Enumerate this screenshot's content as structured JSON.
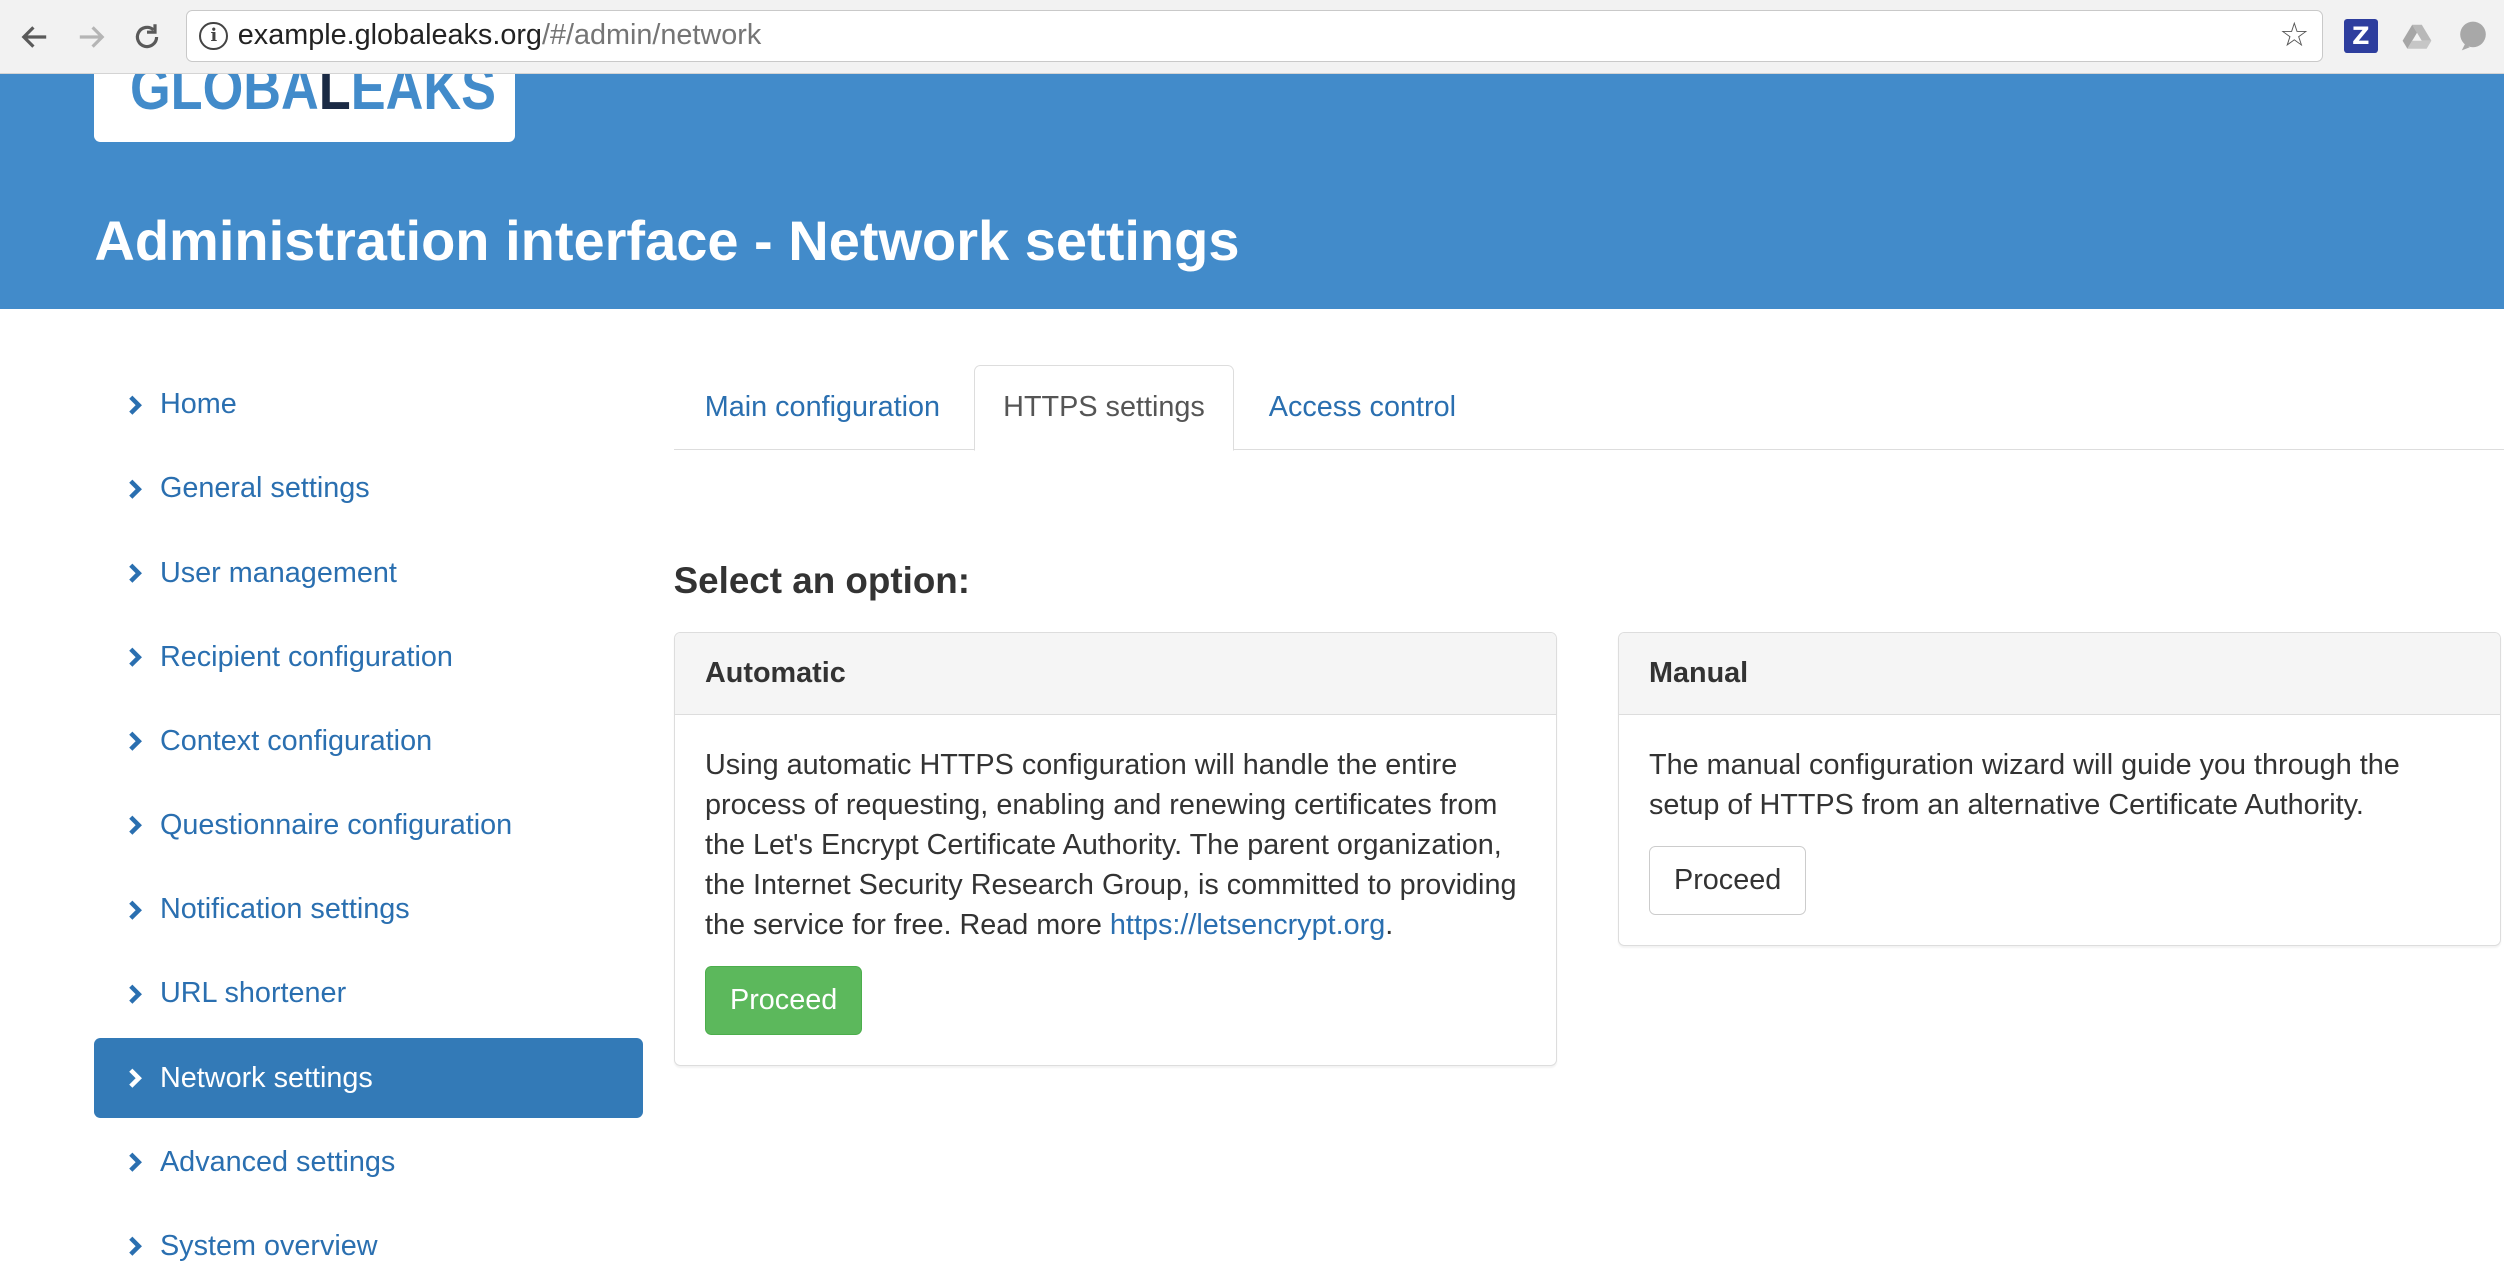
{
  "browser": {
    "url_host": "example.globaleaks.org",
    "url_path": "/#/admin/network",
    "extension_z_label": "Z"
  },
  "header": {
    "logo_part1": "GLOBA",
    "logo_part2": "L",
    "logo_part3": "EAKS",
    "title": "Administration interface - Network settings"
  },
  "sidebar": {
    "items": [
      {
        "label": "Home",
        "active": false
      },
      {
        "label": "General settings",
        "active": false
      },
      {
        "label": "User management",
        "active": false
      },
      {
        "label": "Recipient configuration",
        "active": false
      },
      {
        "label": "Context configuration",
        "active": false
      },
      {
        "label": "Questionnaire configuration",
        "active": false
      },
      {
        "label": "Notification settings",
        "active": false
      },
      {
        "label": "URL shortener",
        "active": false
      },
      {
        "label": "Network settings",
        "active": true
      },
      {
        "label": "Advanced settings",
        "active": false
      },
      {
        "label": "System overview",
        "active": false
      }
    ]
  },
  "tabs": [
    {
      "label": "Main configuration",
      "active": false
    },
    {
      "label": "HTTPS settings",
      "active": true
    },
    {
      "label": "Access control",
      "active": false
    }
  ],
  "main": {
    "section_title": "Select an option:",
    "automatic": {
      "heading": "Automatic",
      "body_text": "Using automatic HTTPS configuration will handle the entire process of requesting, enabling and renewing certificates from the Let's Encrypt Certificate Authority. The parent organization, the Internet Security Research Group, is committed to providing the service for free. Read more ",
      "link_text": "https://letsencrypt.org",
      "body_suffix": ".",
      "button_label": "Proceed"
    },
    "manual": {
      "heading": "Manual",
      "body_text": "The manual configuration wizard will guide you through the setup of HTTPS from an alternative Certificate Authority.",
      "button_label": "Proceed"
    }
  },
  "colors": {
    "header_blue": "#428bca",
    "link_blue": "#2a6fb0",
    "active_nav": "#337ab7",
    "success_green": "#5cb85c"
  },
  "icons": {
    "back": "arrow-left-icon",
    "forward": "arrow-right-icon",
    "reload": "reload-icon",
    "site_info": "info-icon",
    "bookmark": "star-icon",
    "nav_chevron": "chevron-right-icon"
  }
}
